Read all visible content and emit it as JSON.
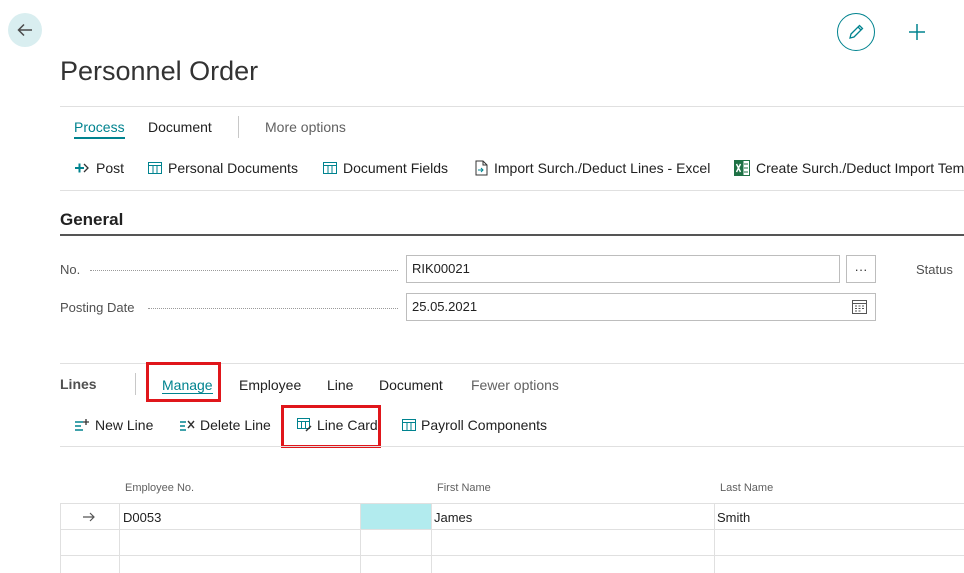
{
  "header": {
    "title": "Personnel Order"
  },
  "tabs": [
    {
      "label": "Process"
    },
    {
      "label": "Document"
    },
    {
      "label": "More options"
    }
  ],
  "actions": [
    {
      "label": "Post",
      "icon": "post-icon"
    },
    {
      "label": "Personal Documents",
      "icon": "list-icon"
    },
    {
      "label": "Document Fields",
      "icon": "list-icon"
    },
    {
      "label": "Import Surch./Deduct Lines - Excel",
      "icon": "import-file-icon"
    },
    {
      "label": "Create Surch./Deduct Import Temp",
      "icon": "excel-icon"
    }
  ],
  "general": {
    "title": "General",
    "no_label": "No.",
    "no_value": "RIK00021",
    "assist_label": "···",
    "posting_date_label": "Posting Date",
    "posting_date_value": "25.05.2021",
    "status_label": "Status"
  },
  "lines": {
    "title": "Lines",
    "tabs": [
      {
        "label": "Manage"
      },
      {
        "label": "Employee"
      },
      {
        "label": "Line"
      },
      {
        "label": "Document"
      },
      {
        "label": "Fewer options"
      }
    ],
    "actions": [
      {
        "label": "New Line"
      },
      {
        "label": "Delete Line"
      },
      {
        "label": "Line Card"
      },
      {
        "label": "Payroll Components"
      }
    ],
    "columns": [
      "Employee No.",
      "First Name",
      "Last Name"
    ],
    "rows": [
      {
        "employee_no": "D0053",
        "first_name": "James",
        "last_name": "Smith"
      }
    ]
  },
  "colors": {
    "accent": "#00838f",
    "highlight_box": "#e0161b",
    "selected_cell": "#b2ebee"
  }
}
